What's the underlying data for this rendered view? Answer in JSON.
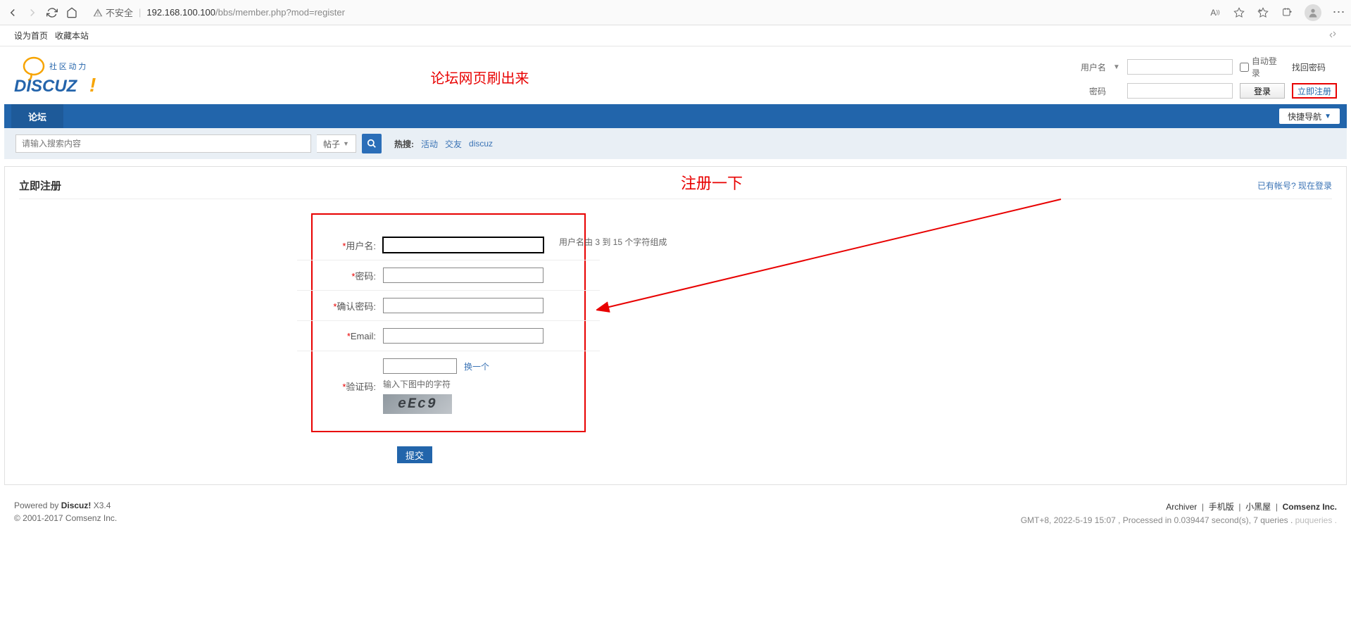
{
  "browser": {
    "insecure": "不安全",
    "url_ip": "192.168.100.100",
    "url_path": "/bbs/member.php?mod=register"
  },
  "toolbar2": {
    "set_home": "设为首页",
    "favorite": "收藏本站"
  },
  "annotation1": "论坛网页刷出来",
  "annotation2": "注册一下",
  "login": {
    "user_label": "用户名",
    "pass_label": "密码",
    "auto_label": "自动登录",
    "forgot": "找回密码",
    "login_btn": "登录",
    "reg_link": "立即注册"
  },
  "nav": {
    "forum": "论坛",
    "quick": "快捷导航"
  },
  "search": {
    "placeholder": "请输入搜索内容",
    "type": "帖子",
    "hot_label": "热搜:",
    "hot_links": [
      "活动",
      "交友",
      "discuz"
    ]
  },
  "panel": {
    "title": "立即注册",
    "already": "已有帐号? 现在登录"
  },
  "form": {
    "username": "用户名:",
    "username_hint": "用户名由 3 到 15 个字符组成",
    "password": "密码:",
    "confirm": "确认密码:",
    "email": "Email:",
    "captcha": "验证码:",
    "captcha_refresh": "换一个",
    "captcha_hint": "输入下图中的字符",
    "captcha_text": "eEc9",
    "submit": "提交"
  },
  "footer": {
    "powered": "Powered by ",
    "discuz": "Discuz!",
    "ver": " X3.4",
    "copyright": "© 2001-2017 Comsenz Inc.",
    "archiver": "Archiver",
    "mobile": "手机版",
    "blackroom": "小黑屋",
    "comsenz": "Comsenz Inc.",
    "stats": "GMT+8, 2022-5-19 15:07 , Processed in 0.039447 second(s), 7 queries .",
    "watermark": "puqueries ."
  }
}
